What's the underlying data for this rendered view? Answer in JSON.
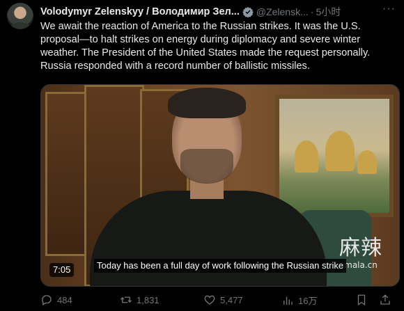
{
  "tweet": {
    "author_name": "Volodymyr Zelenskyy / Володимир Зел...",
    "handle": "@Zelensk...",
    "separator": "·",
    "time": "5小时",
    "more_icon": "ellipsis-icon",
    "verified_icon": "verified-badge-icon",
    "verified_color": "#1d9bf0",
    "text": "We await the reaction of America to the Russian strikes. It was the U.S. proposal—to halt strikes on energy during diplomacy and severe winter weather. The President of the United States made the request personally. Russia responded with a record number of ballistic missiles."
  },
  "media": {
    "duration": "7:05",
    "caption": "Today has been a full day of work following the Russian strike",
    "watermark_chars": "麻辣",
    "watermark_domain": "mala.cn"
  },
  "actions": {
    "replies": "484",
    "retweets": "1,831",
    "likes": "5,477",
    "views": "16万",
    "reply_icon": "reply-icon",
    "retweet_icon": "retweet-icon",
    "like_icon": "heart-icon",
    "views_icon": "views-chart-icon",
    "bookmark_icon": "bookmark-icon",
    "share_icon": "share-icon"
  }
}
